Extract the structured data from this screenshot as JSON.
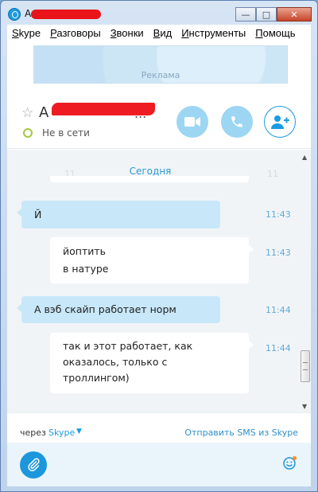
{
  "window": {
    "title_prefix": "A",
    "buttons": {
      "minimize": "—",
      "maximize": "□",
      "close": "✕"
    }
  },
  "menu": [
    {
      "label": "Skype",
      "accel": "S",
      "rest": "kype"
    },
    {
      "label": "Разговоры",
      "accel": "Р",
      "rest": "азговоры"
    },
    {
      "label": "Звонки",
      "accel": "З",
      "rest": "вонки"
    },
    {
      "label": "Вид",
      "accel": "В",
      "rest": "ид"
    },
    {
      "label": "Инструменты",
      "accel": "И",
      "rest": "нструменты"
    },
    {
      "label": "Помощь",
      "accel": "П",
      "rest": "омощь"
    }
  ],
  "ad": {
    "label": "Реклама"
  },
  "contact": {
    "name_prefix": "A",
    "name_suffix": "...",
    "status": "Не в сети"
  },
  "chat": {
    "date_separator": "Сегодня",
    "ghost_time": "11",
    "messages": [
      {
        "direction": "in",
        "lines": [
          "Й"
        ],
        "time": "11:43"
      },
      {
        "direction": "out",
        "lines": [
          "йоптить",
          "в натуре"
        ],
        "time": "11:43"
      },
      {
        "direction": "in",
        "lines": [
          "А вэб скайп работает норм"
        ],
        "time": "11:44"
      },
      {
        "direction": "out",
        "lines": [
          "так и этот работает, как",
          "оказалось, только с",
          "троллингом)"
        ],
        "time": "11:44"
      }
    ]
  },
  "footer": {
    "via_label": "через",
    "via_service": "Skype",
    "sms_link": "Отправить SMS из Skype"
  },
  "colors": {
    "accent": "#1b9ce3",
    "bubble_in": "#c8e8f9",
    "bubble_out": "#ffffff",
    "status_offline": "#a3c93a",
    "redaction": "#ee1c22"
  }
}
